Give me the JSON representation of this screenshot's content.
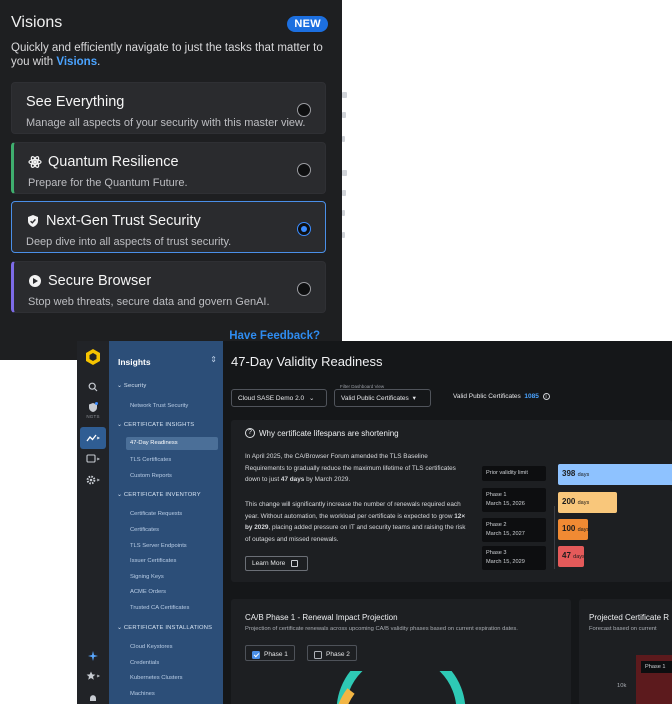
{
  "visions": {
    "title": "Visions",
    "badge": "NEW",
    "description_prefix": "Quickly and efficiently navigate to just the tasks that matter to you with ",
    "description_link": "Visions",
    "description_suffix": ".",
    "options": [
      {
        "title": "See Everything",
        "subtitle": "Manage all aspects of your security with this master view.",
        "selected": false
      },
      {
        "title": "Quantum Resilience",
        "subtitle": "Prepare for the Quantum Future.",
        "selected": false,
        "icon": "atom-icon"
      },
      {
        "title": "Next-Gen Trust Security",
        "subtitle": "Deep dive into all aspects of trust security.",
        "selected": true,
        "icon": "shield-check-icon"
      },
      {
        "title": "Secure Browser",
        "subtitle": "Stop web threats, secure data and govern GenAI.",
        "selected": false,
        "icon": "browser-icon"
      }
    ],
    "feedback": "Have Feedback?"
  },
  "rail": {
    "tag": "NGTS",
    "icons": [
      "logo-icon",
      "search-icon",
      "shield-icon",
      "insights-icon",
      "certificate-icon",
      "gear-icon",
      "sparkle-icon",
      "star-icon",
      "bell-icon"
    ]
  },
  "nav": {
    "header": "Insights",
    "items": [
      {
        "label": "Security",
        "type": "section"
      },
      {
        "label": "Network Trust Security",
        "type": "sub"
      },
      {
        "label": "CERTIFICATE INSIGHTS",
        "type": "section"
      },
      {
        "label": "47-Day Readiness",
        "type": "sub",
        "selected": true
      },
      {
        "label": "TLS Certificates",
        "type": "sub"
      },
      {
        "label": "Custom Reports",
        "type": "sub"
      },
      {
        "label": "CERTIFICATE INVENTORY",
        "type": "section"
      },
      {
        "label": "Certificate Requests",
        "type": "sub"
      },
      {
        "label": "Certificates",
        "type": "sub"
      },
      {
        "label": "TLS Server Endpoints",
        "type": "sub"
      },
      {
        "label": "Issuer Certificates",
        "type": "sub"
      },
      {
        "label": "Signing Keys",
        "type": "sub"
      },
      {
        "label": "ACME Orders",
        "type": "sub"
      },
      {
        "label": "Trusted CA Certificates",
        "type": "sub"
      },
      {
        "label": "CERTIFICATE INSTALLATIONS",
        "type": "section"
      },
      {
        "label": "Cloud Keystores",
        "type": "sub"
      },
      {
        "label": "Credentials",
        "type": "sub"
      },
      {
        "label": "Kubernetes Clusters",
        "type": "sub"
      },
      {
        "label": "Machines",
        "type": "sub"
      }
    ]
  },
  "main": {
    "title": "47-Day Validity Readiness",
    "tenant_select": "Cloud SASE Demo 2.0",
    "filter_label": "Filter Dashboard View",
    "filter_select": "Valid Public Certificates",
    "valid_label": "Valid Public Certificates",
    "valid_count": "1085",
    "why": {
      "heading": "Why certificate lifespans are shortening",
      "para1_a": "In April 2025, the CA/Browser Forum amended the TLS Baseline Requirements to gradually reduce the maximum lifetime of TLS certificates down to just ",
      "para1_b": "47 days",
      "para1_c": " by March 2029.",
      "para2_a": "This change will significantly increase the number of renewals required each year. Without automation, the workload per certificate is expected to grow ",
      "para2_b": "12× by 2029",
      "para2_c": ", placing added pressure on IT and security teams and raising the risk of outages and missed renewals.",
      "learn_more": "Learn More"
    },
    "phases": [
      {
        "label": "Prior validity limit",
        "date": "",
        "days": 398,
        "unit": "days",
        "color": "#8ec2ff"
      },
      {
        "label": "Phase 1",
        "date": "March 15, 2026",
        "days": 200,
        "unit": "days",
        "color": "#f9c77b"
      },
      {
        "label": "Phase 2",
        "date": "March 15, 2027",
        "days": 100,
        "unit": "days",
        "color": "#f08a33"
      },
      {
        "label": "Phase 3",
        "date": "March 15, 2029",
        "days": 47,
        "unit": "days",
        "color": "#e45a5a"
      }
    ],
    "impact": {
      "title": "CA/B Phase 1 - Renewal Impact Projection",
      "subtitle": "Projection of certificate renewals across upcoming CA/B validity phases based on current expiration dates.",
      "checkboxes": [
        {
          "label": "Phase 1",
          "checked": true
        },
        {
          "label": "Phase 2",
          "checked": false
        }
      ]
    },
    "projected": {
      "title": "Projected Certificate R",
      "subtitle": "Forecast based on current",
      "tag": "Phase 1",
      "axis": "10k"
    }
  }
}
